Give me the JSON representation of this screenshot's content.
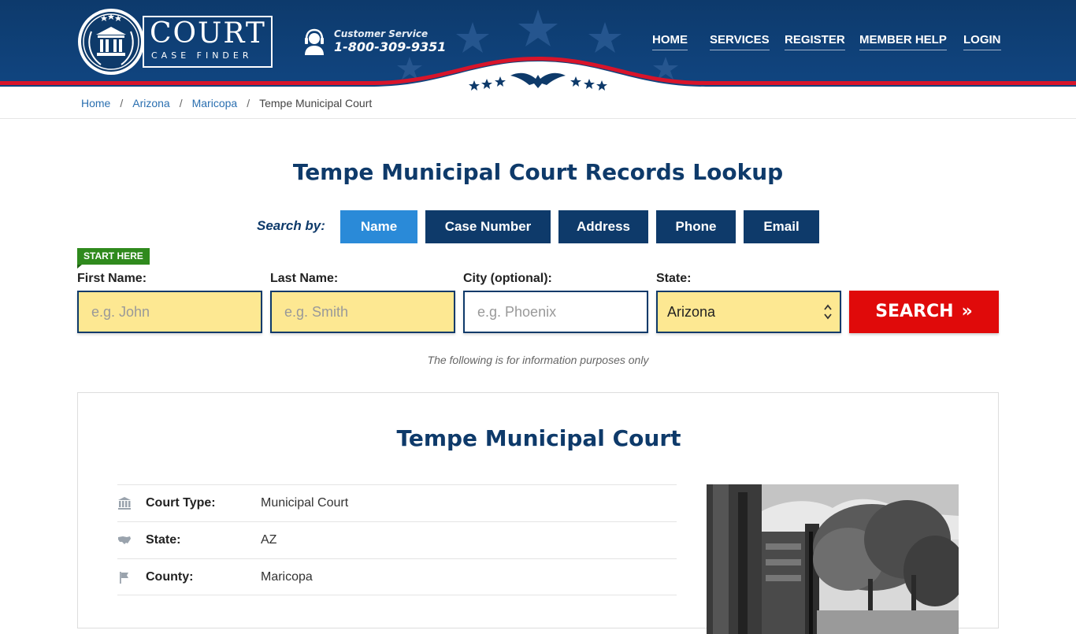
{
  "brand": {
    "name": "COURT",
    "tagline": "CASE FINDER"
  },
  "customer_service": {
    "label": "Customer Service",
    "phone": "1-800-309-9351",
    "icon": "headset-icon"
  },
  "nav": {
    "items": [
      {
        "label": "HOME"
      },
      {
        "label": "SERVICES"
      },
      {
        "label": "REGISTER"
      },
      {
        "label": "MEMBER HELP"
      },
      {
        "label": "LOGIN"
      }
    ]
  },
  "breadcrumb": {
    "items": [
      {
        "label": "Home"
      },
      {
        "label": "Arizona"
      },
      {
        "label": "Maricopa"
      }
    ],
    "current": "Tempe Municipal Court",
    "separator": "/"
  },
  "page": {
    "title": "Tempe Municipal Court Records Lookup"
  },
  "search_by": {
    "label": "Search by:",
    "tabs": [
      {
        "label": "Name",
        "active": true
      },
      {
        "label": "Case Number",
        "active": false
      },
      {
        "label": "Address",
        "active": false
      },
      {
        "label": "Phone",
        "active": false
      },
      {
        "label": "Email",
        "active": false
      }
    ]
  },
  "form": {
    "badge": "START HERE",
    "first_name": {
      "label": "First Name:",
      "placeholder": "e.g. John"
    },
    "last_name": {
      "label": "Last Name:",
      "placeholder": "e.g. Smith"
    },
    "city": {
      "label": "City (optional):",
      "placeholder": "e.g.  Phoenix"
    },
    "state": {
      "label": "State:",
      "value": "Arizona"
    },
    "search_button": "SEARCH",
    "search_chevron": "»"
  },
  "info_note": "The following is for information purposes only",
  "court": {
    "name": "Tempe Municipal Court",
    "details": [
      {
        "key": "Court Type:",
        "value": "Municipal Court",
        "icon": "courthouse-icon"
      },
      {
        "key": "State:",
        "value": "AZ",
        "icon": "us-map-icon"
      },
      {
        "key": "County:",
        "value": "Maricopa",
        "icon": "flag-icon"
      }
    ]
  },
  "colors": {
    "navy": "#0e3a6a",
    "header_blue": "#0e3f75",
    "active_tab": "#2a8ad8",
    "search_red": "#e00a0a",
    "field_yellow": "#fde892",
    "start_green": "#2f8a1d",
    "link_blue": "#2a6fb0"
  }
}
